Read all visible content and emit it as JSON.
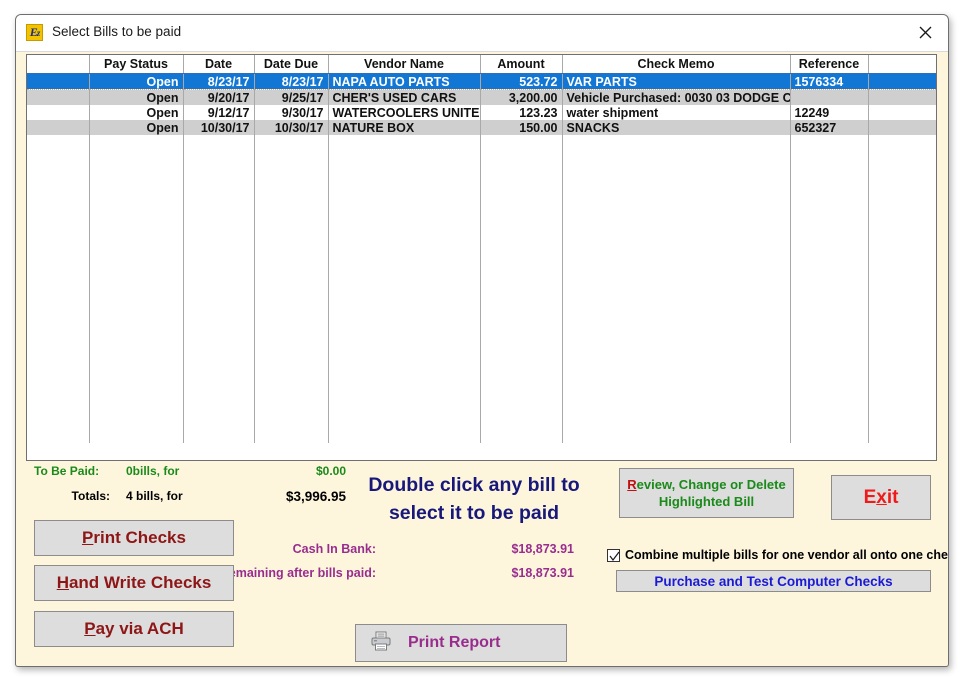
{
  "window": {
    "title": "Select Bills to be paid",
    "icon": "ez-app-icon",
    "close_icon": "close-icon"
  },
  "grid": {
    "columns": [
      "",
      "Pay Status",
      "Date",
      "Date Due",
      "Vendor Name",
      "Amount",
      "Check Memo",
      "Reference",
      ""
    ],
    "rows": [
      {
        "selected": true,
        "marker": "",
        "pay_status": "Open",
        "date": "8/23/17",
        "date_due": "8/23/17",
        "vendor": "NAPA AUTO PARTS",
        "amount": "523.72",
        "memo": "VAR PARTS",
        "reference": "1576334",
        "extra": ""
      },
      {
        "selected": false,
        "marker": "",
        "pay_status": "Open",
        "date": "9/20/17",
        "date_due": "9/25/17",
        "vendor": "CHER'S USED CARS",
        "amount": "3,200.00",
        "memo": "Vehicle Purchased: 0030 03 DODGE C",
        "reference": "",
        "extra": ""
      },
      {
        "selected": false,
        "marker": "",
        "pay_status": "Open",
        "date": "9/12/17",
        "date_due": "9/30/17",
        "vendor": "WATERCOOLERS UNITED",
        "amount": "123.23",
        "memo": "water shipment",
        "reference": "12249",
        "extra": ""
      },
      {
        "selected": false,
        "marker": "",
        "pay_status": "Open",
        "date": "10/30/17",
        "date_due": "10/30/17",
        "vendor": "NATURE BOX",
        "amount": "150.00",
        "memo": "SNACKS",
        "reference": "652327",
        "extra": ""
      }
    ]
  },
  "totals": {
    "to_be_paid_label": "To Be Paid:",
    "to_be_paid_count": "0bills, for",
    "to_be_paid_amount": "$0.00",
    "totals_label": "Totals:",
    "totals_count": "4 bills, for",
    "totals_amount": "$3,996.95"
  },
  "cash": {
    "in_bank_label": "Cash In Bank:",
    "in_bank_value": "$18,873.91",
    "remaining_label": "Cash remaining after bills paid:",
    "remaining_value": "$18,873.91"
  },
  "hint": {
    "line1": "Double click any bill to",
    "line2": "select it to be paid"
  },
  "buttons": {
    "print_checks": {
      "prefix": "P",
      "rest": "rint Checks"
    },
    "hand_write_checks": {
      "prefix": "H",
      "rest": "and Write Checks"
    },
    "pay_via_ach": {
      "prefix": "P",
      "rest": "ay via ACH"
    },
    "review": {
      "prefix": "R",
      "rest": "eview, Change or Delete",
      "line2": "Highlighted Bill"
    },
    "exit": {
      "pre": "E",
      "mid": "x",
      "post": "it"
    },
    "purchase": "Purchase and Test Computer Checks",
    "print_report": "Print Report",
    "print_report_icon": "printer-icon"
  },
  "combine": {
    "label": "Combine multiple bills for one vendor all onto one check",
    "checked": true,
    "check_icon": "checkmark-icon"
  },
  "colors": {
    "window_bg": "#fdf6dd",
    "selection_blue": "#1277d4",
    "alt_row_gray": "#cfcfcf",
    "green_text": "#1a8a1a",
    "purple_text": "#992d8e",
    "maroon_text": "#8e1616",
    "navy_hint": "#18187a",
    "red_exit": "#ef1a1a",
    "blue_link": "#1a1ad6"
  }
}
